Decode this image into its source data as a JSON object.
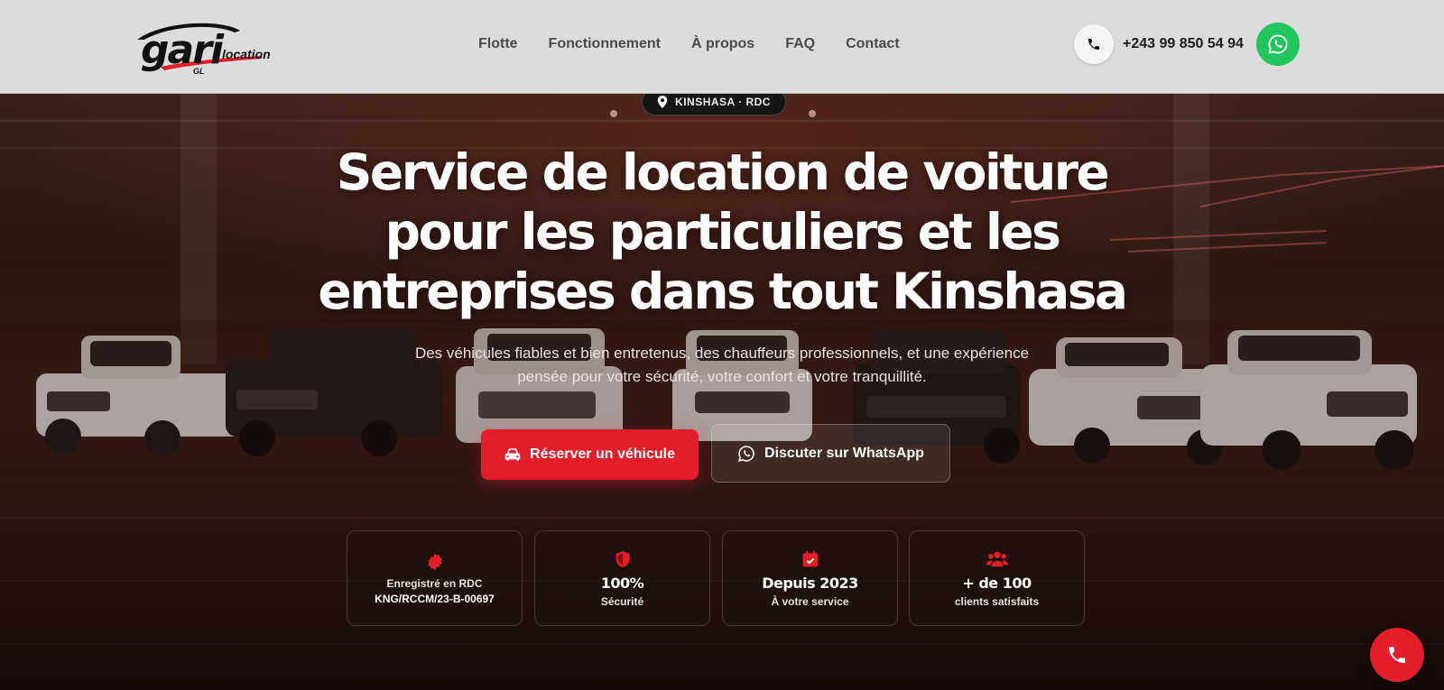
{
  "header": {
    "logo": {
      "brand": "gari",
      "word": "location",
      "mark": "GL"
    },
    "nav": [
      "Flotte",
      "Fonctionnement",
      "À propos",
      "FAQ",
      "Contact"
    ],
    "phone_icon": "phone-icon",
    "phone_number": "+243 99 850 54 94",
    "whatsapp_icon": "whatsapp-icon"
  },
  "hero": {
    "location_badge": "KINSHASA · RDC",
    "title": "Service de location de voiture pour les particuliers et les entreprises dans tout Kinshasa",
    "subtitle": "Des véhicules fiables et bien entretenus, des chauffeurs professionnels, et une expérience pensée pour votre sécurité, votre confort et votre tranquillité.",
    "primary_button": "Réserver un véhicule",
    "secondary_button": "Discuter sur WhatsApp"
  },
  "stats": [
    {
      "icon": "badge-icon",
      "line1": "Enregistré en RDC",
      "line2": "KNG/RCCM/23-B-00697"
    },
    {
      "icon": "shield-icon",
      "big": "100%",
      "small": "Sécurité"
    },
    {
      "icon": "calendar-check-icon",
      "big": "Depuis 2023",
      "small": "À votre service"
    },
    {
      "icon": "users-icon",
      "big": "+ de 100",
      "small": "clients satisfaits"
    }
  ],
  "colors": {
    "accent": "#e41d2b",
    "whatsapp": "#21c65e",
    "header_bg": "#dcdcdc"
  },
  "call_fab_icon": "phone-icon"
}
